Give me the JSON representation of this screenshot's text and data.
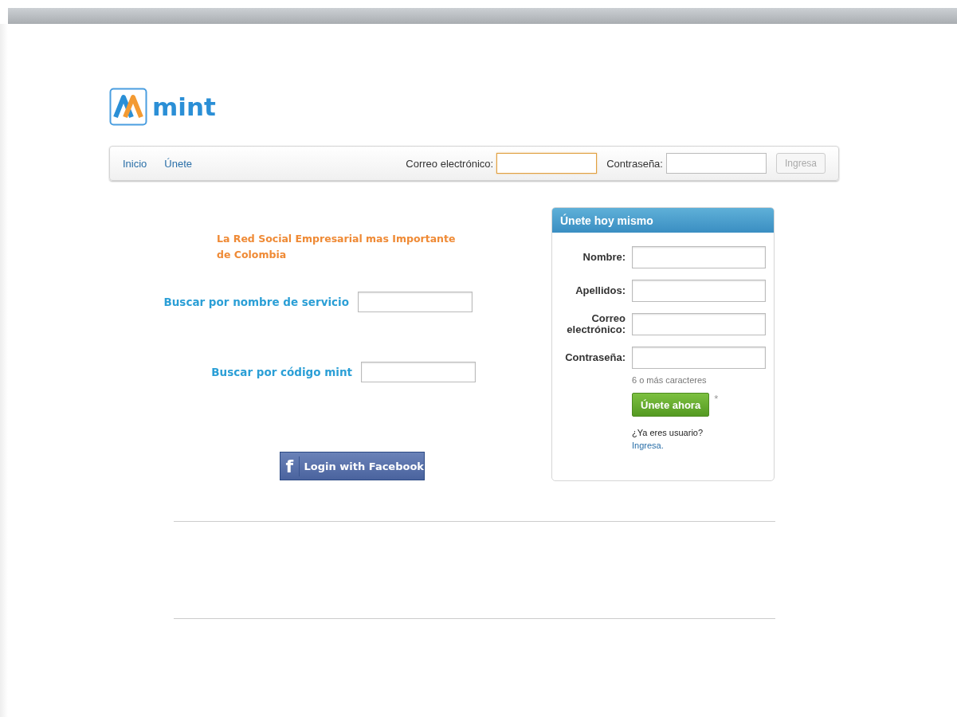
{
  "logo": {
    "text": "mint"
  },
  "nav": {
    "links": [
      {
        "label": "Inicio"
      },
      {
        "label": "Únete"
      }
    ],
    "login": {
      "fields": [
        {
          "label": "Correo electrónico:",
          "focused": true
        },
        {
          "label": "Contraseña:",
          "focused": false
        }
      ],
      "button": {
        "label": "Ingresa",
        "disabled": true
      }
    }
  },
  "tagline": "La Red Social Empresarial mas Importante de Colombia",
  "searches": [
    {
      "label": "Buscar por nombre de servicio"
    },
    {
      "label": "Buscar por código mint"
    }
  ],
  "facebook_button": {
    "icon": "f",
    "label": "Login with Facebook"
  },
  "signup": {
    "title": "Únete hoy mismo",
    "fields": [
      {
        "label": "Nombre:"
      },
      {
        "label": "Apellidos:"
      },
      {
        "label": "Correo electrónico:"
      },
      {
        "label": "Contraseña:",
        "hint": "6 o más caracteres"
      }
    ],
    "button": "Únete ahora",
    "required_mark": "*",
    "question": "¿Ya eres usuario?",
    "link": "Ingresa."
  }
}
